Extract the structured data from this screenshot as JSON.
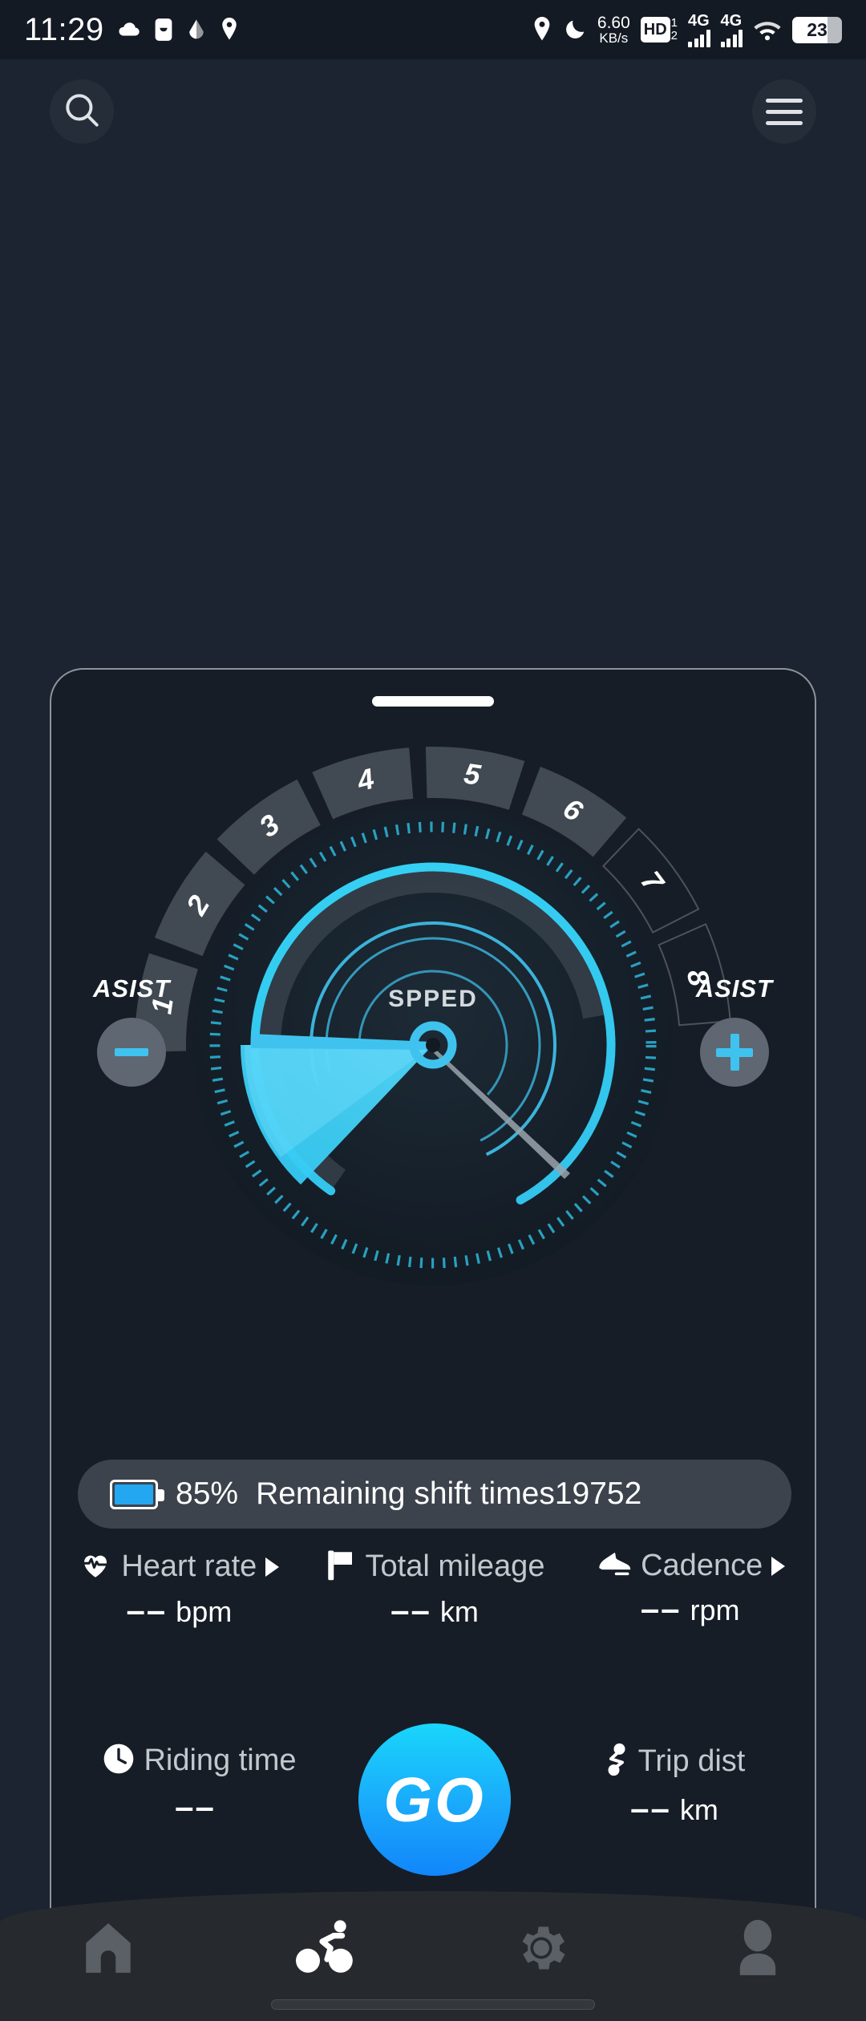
{
  "status_bar": {
    "clock": "11:29",
    "left_icons": [
      "cloud-icon",
      "sim-card-icon",
      "water-drop-icon",
      "location-pin-icon"
    ],
    "network_speed_value": "6.60",
    "network_speed_unit": "KB/s",
    "hd_label": "HD",
    "sim_slot_top": "1",
    "sim_slot_bottom": "2",
    "signal_1_label": "4G",
    "signal_2_label": "4G",
    "battery_level": "23",
    "right_icons": [
      "location-pin-icon",
      "do-not-disturb-moon-icon",
      "hd-dual-sim-icon",
      "signal-4g-icon",
      "signal-4g-icon",
      "wifi-icon",
      "battery-icon"
    ]
  },
  "header": {
    "search_icon": "search-icon",
    "menu_icon": "hamburger-menu-icon"
  },
  "gauge": {
    "center_label": "SPPED",
    "gears": [
      "1",
      "2",
      "3",
      "4",
      "5",
      "6",
      "7",
      "8"
    ],
    "active_gear_count": 6,
    "assist_left_label": "ASIST",
    "assist_right_label": "ASIST",
    "assist_decrease_icon": "minus-icon",
    "assist_increase_icon": "plus-icon"
  },
  "battery_bar": {
    "icon": "battery-icon",
    "percent": "85%",
    "text": "Remaining shift times19752"
  },
  "metrics": [
    {
      "icon": "heart-rate-icon",
      "label": "Heart rate",
      "has_caret": true,
      "value": "––",
      "unit": "bpm"
    },
    {
      "icon": "flag-icon",
      "label": "Total mileage",
      "has_caret": false,
      "value": "––",
      "unit": "km"
    },
    {
      "icon": "shoe-cadence-icon",
      "label": "Cadence",
      "has_caret": true,
      "value": "––",
      "unit": "rpm"
    }
  ],
  "bottom_row": {
    "riding_time": {
      "icon": "clock-icon",
      "label": "Riding time",
      "value": "––",
      "unit": ""
    },
    "go_button": {
      "label": "GO"
    },
    "trip_dist": {
      "icon": "route-icon",
      "label": "Trip dist",
      "value": "––",
      "unit": "km"
    }
  },
  "nav": {
    "items": [
      {
        "icon": "home-icon",
        "active": false
      },
      {
        "icon": "cycling-icon",
        "active": true
      },
      {
        "icon": "settings-gear-icon",
        "active": false
      },
      {
        "icon": "profile-person-icon",
        "active": false
      }
    ]
  },
  "colors": {
    "accent_cyan": "#3fc3ee",
    "go_gradient_start": "#19d6fb",
    "go_gradient_end": "#1186fb",
    "card_bg": "#161d27",
    "page_bg": "#1b2430"
  }
}
